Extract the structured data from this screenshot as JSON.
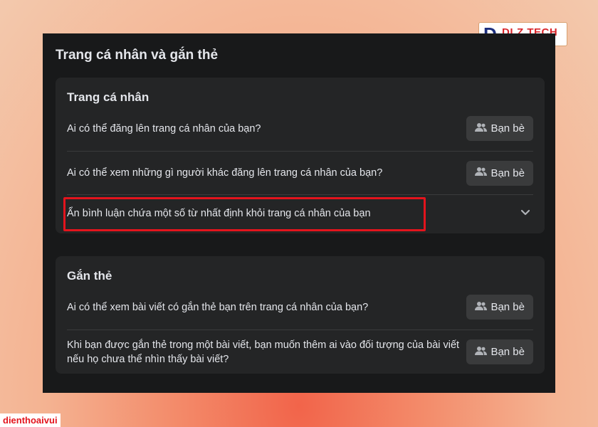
{
  "panel": {
    "title": "Trang cá nhân và gắn thẻ"
  },
  "profile_section": {
    "heading": "Trang cá nhân",
    "rows": [
      {
        "label": "Ai có thể đăng lên trang cá nhân của bạn?",
        "button": "Bạn bè",
        "icon": "friends-icon"
      },
      {
        "label": "Ai có thể xem những gì người khác đăng lên trang cá nhân của bạn?",
        "button": "Bạn bè",
        "icon": "friends-icon"
      },
      {
        "label": "Ẩn bình luận chứa một số từ nhất định khỏi trang cá nhân của bạn",
        "icon": "chevron-down-icon",
        "highlighted": true
      }
    ]
  },
  "tagging_section": {
    "heading": "Gắn thẻ",
    "rows": [
      {
        "label": "Ai có thể xem bài viết có gắn thẻ bạn trên trang cá nhân của bạn?",
        "button": "Bạn bè",
        "icon": "friends-icon"
      },
      {
        "label": "Khi bạn được gắn thẻ trong một bài viết, bạn muốn thêm ai vào đối tượng của bài viết nếu họ chưa thể nhìn thấy bài viết?",
        "button": "Bạn bè",
        "icon": "friends-icon"
      }
    ]
  },
  "logo": {
    "mark": "D",
    "name": "DLZ TECH"
  },
  "watermark": {
    "text": "dienthoaivui"
  },
  "colors": {
    "highlight": "#e3141d",
    "panel_bg": "#18191a",
    "card_bg": "#242526",
    "button_bg": "#3a3b3c"
  }
}
